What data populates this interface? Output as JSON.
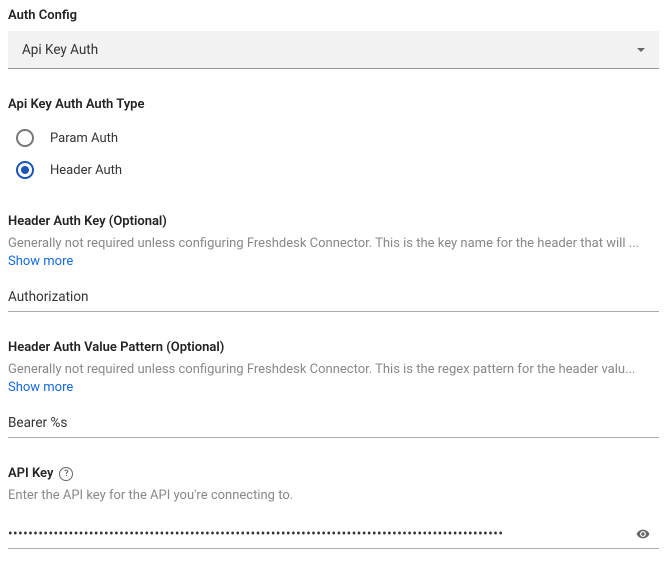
{
  "authConfig": {
    "label": "Auth Config",
    "selected": "Api Key Auth"
  },
  "authType": {
    "label": "Api Key Auth Auth Type",
    "options": [
      {
        "label": "Param Auth",
        "selected": false
      },
      {
        "label": "Header Auth",
        "selected": true
      }
    ]
  },
  "headerAuthKey": {
    "label": "Header Auth Key (Optional)",
    "description": "Generally not required unless configuring Freshdesk Connector. This is the key name for the header that will ...",
    "showMore": "Show more",
    "value": "Authorization"
  },
  "headerAuthValuePattern": {
    "label": "Header Auth Value Pattern (Optional)",
    "description": "Generally not required unless configuring Freshdesk Connector. This is the regex pattern for the header valu...",
    "showMore": "Show more",
    "value": "Bearer %s"
  },
  "apiKey": {
    "label": "API Key",
    "description": "Enter the API key for the API you're connecting to.",
    "value": "••••••••••••••••••••••••••••••••••••••••••••••••••••••••••••••••••••••••••••••••••••••••••••••••••"
  }
}
